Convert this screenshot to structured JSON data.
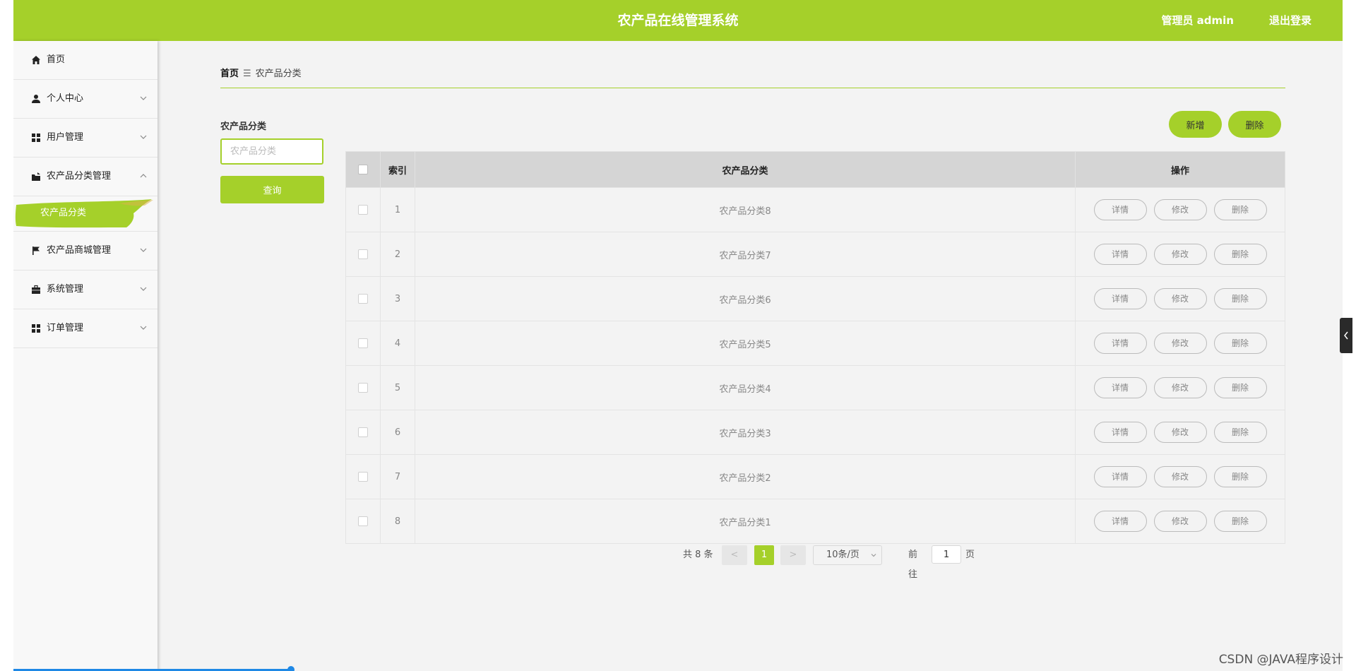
{
  "header": {
    "title": "农产品在线管理系统",
    "user": "管理员 admin",
    "logout": "退出登录"
  },
  "sidebar": {
    "items": [
      {
        "label": "首页",
        "icon": "home-icon"
      },
      {
        "label": "个人中心",
        "icon": "user-icon"
      },
      {
        "label": "用户管理",
        "icon": "grid-icon"
      },
      {
        "label": "农产品分类管理",
        "icon": "folder-icon",
        "expanded": true
      },
      {
        "label": "农产品商城管理",
        "icon": "flag-icon"
      },
      {
        "label": "系统管理",
        "icon": "briefcase-icon"
      },
      {
        "label": "订单管理",
        "icon": "grid-icon"
      }
    ],
    "active_sub": "农产品分类"
  },
  "breadcrumb": {
    "home": "首页",
    "separator": "☰",
    "current": "农产品分类"
  },
  "filter": {
    "label": "农产品分类",
    "placeholder": "农产品分类",
    "query_button": "查询"
  },
  "actions": {
    "add": "新增",
    "delete": "删除"
  },
  "table": {
    "headers": {
      "index": "索引",
      "category": "农产品分类",
      "ops": "操作"
    },
    "ops": {
      "detail": "详情",
      "edit": "修改",
      "delete": "删除"
    },
    "rows": [
      {
        "index": "1",
        "category": "农产品分类8"
      },
      {
        "index": "2",
        "category": "农产品分类7"
      },
      {
        "index": "3",
        "category": "农产品分类6"
      },
      {
        "index": "4",
        "category": "农产品分类5"
      },
      {
        "index": "5",
        "category": "农产品分类4"
      },
      {
        "index": "6",
        "category": "农产品分类3"
      },
      {
        "index": "7",
        "category": "农产品分类2"
      },
      {
        "index": "8",
        "category": "农产品分类1"
      }
    ]
  },
  "pagination": {
    "total": "共 8 条",
    "prev": "<",
    "current": "1",
    "next": ">",
    "page_size": "10条/页",
    "goto": "前往",
    "goto_value": "1",
    "page_word": "页"
  },
  "watermark": "CSDN @JAVA程序设计",
  "colors": {
    "accent": "#a5d02a",
    "background": "#f3f3f3"
  }
}
